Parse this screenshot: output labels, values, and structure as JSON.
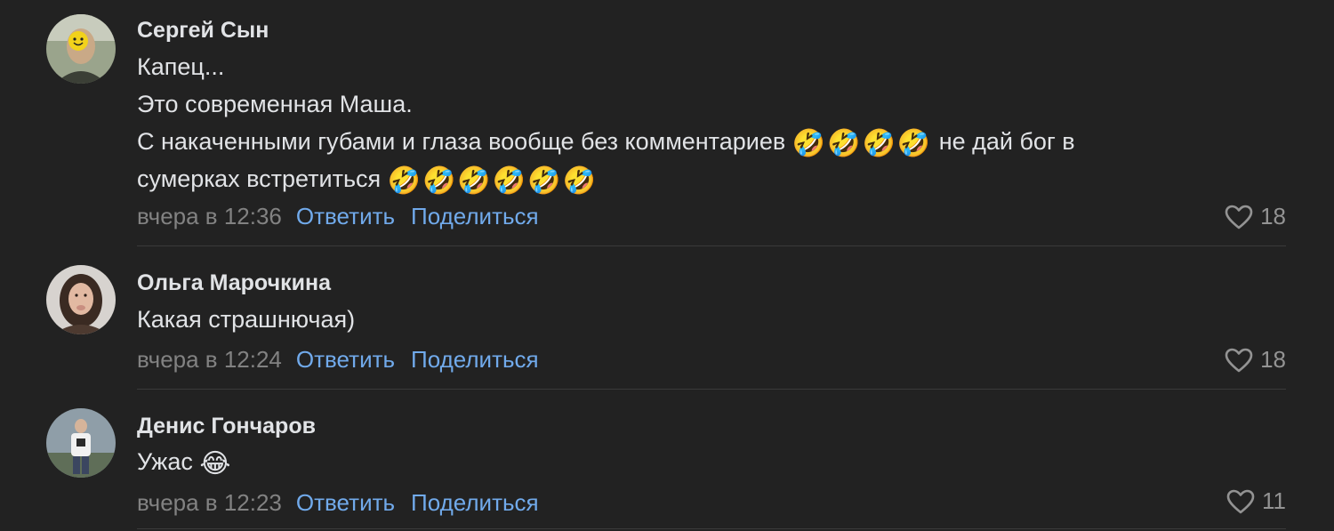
{
  "comments": [
    {
      "author": "Сергей Сын",
      "lines": [
        "Капец...",
        "Это современная Маша.",
        "С накаченными губами и глаза вообще без комментариев",
        "не дай бог в",
        "сумеркax встретиться"
      ],
      "emoji_1": "🤣🤣🤣🤣",
      "emoji_2": "🤣🤣🤣🤣🤣🤣",
      "time": "вчера в 12:36",
      "reply_label": "Ответить",
      "share_label": "Поделиться",
      "likes": "18"
    },
    {
      "author": "Ольга Марочкина",
      "lines": [
        "Какая страшнючая)"
      ],
      "time": "вчера в 12:24",
      "reply_label": "Ответить",
      "share_label": "Поделиться",
      "likes": "18"
    },
    {
      "author": "Денис Гончаров",
      "lines": [
        "Ужас"
      ],
      "emoji_1": "😂",
      "time": "вчера в 12:23",
      "reply_label": "Ответить",
      "share_label": "Поделиться",
      "likes": "11"
    }
  ],
  "icons": {
    "like": "heart-icon"
  },
  "colors": {
    "background": "#222222",
    "text": "#e1e3e6",
    "link": "#71aaeb",
    "muted": "#828282"
  }
}
